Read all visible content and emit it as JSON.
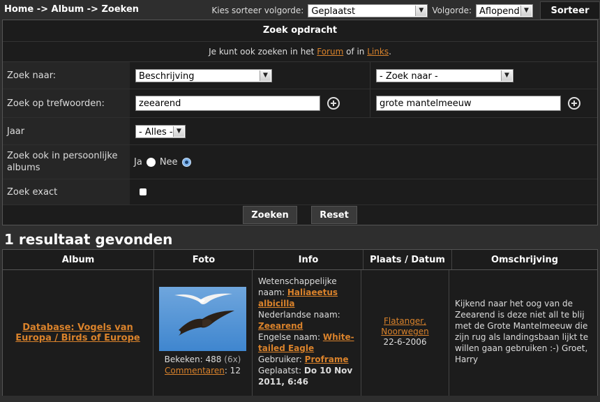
{
  "breadcrumb": "Home -> Album -> Zoeken",
  "sort": {
    "label": "Kies sorteer volgorde:",
    "selected": "Geplaatst",
    "order_label": "Volgorde:",
    "order_selected": "Aflopend",
    "button": "Sorteer"
  },
  "panel": {
    "title": "Zoek opdracht",
    "sub_prefix": "Je kunt ook zoeken in het",
    "sub_forum": "Forum",
    "sub_mid": "of in",
    "sub_links": "Links",
    "sub_suffix": ".",
    "rows": {
      "search_for_label": "Zoek naar:",
      "search_for_value": "Beschrijving",
      "search_for_value2": "- Zoek naar -",
      "keywords_label": "Zoek op trefwoorden:",
      "keyword1": "zeearend",
      "keyword2": "grote mantelmeeuw",
      "year_label": "Jaar",
      "year_value": "- Alles -",
      "personal_label": "Zoek ook in persoonlijke albums",
      "yes": "Ja",
      "no": "Nee",
      "exact_label": "Zoek exact"
    },
    "search_button": "Zoeken",
    "reset_button": "Reset"
  },
  "results": {
    "heading": "1 resultaat gevonden",
    "columns": [
      "Album",
      "Foto",
      "Info",
      "Plaats / Datum",
      "Omschrijving"
    ],
    "row": {
      "album": "Database: Vogels van Europa / Birds of Europe",
      "views_label": "Bekeken:",
      "views": "488",
      "views_count": "(6x)",
      "comments_link": "Commentaren",
      "comments_count": ": 12",
      "sci_label": "Wetenschappelijke naam:",
      "sci_name": "Haliaeetus albicilla",
      "nl_label": "Nederlandse naam:",
      "nl_name": "Zeearend",
      "en_label": "Engelse naam:",
      "en_name": "White-tailed Eagle",
      "user_label": "Gebruiker:",
      "user": "Proframe",
      "placed_label": "Geplaatst:",
      "placed": "Do 10 Nov 2011, 6:46",
      "place": "Flatanger, Noorwegen",
      "date": "22-6-2006",
      "description": "Kijkend naar het oog van de Zeearend is deze niet all te blij met de Grote Mantelmeeuw die zijn rug als landingsbaan lijkt te willen gaan gebruiken :-) Groet, Harry"
    }
  }
}
